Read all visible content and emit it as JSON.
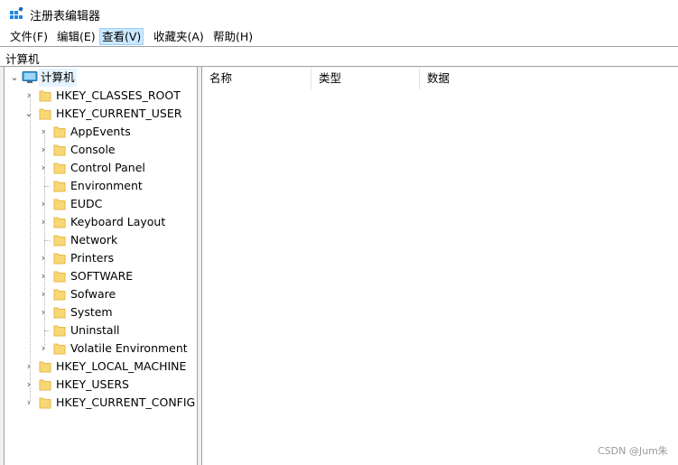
{
  "window": {
    "title": "注册表编辑器",
    "icon": "registry-editor-icon"
  },
  "menu": [
    "文件(F)",
    "编辑(E)",
    "查看(V)",
    "收藏夹(A)",
    "帮助(H)"
  ],
  "address": "计算机",
  "tree": {
    "root": "计算机",
    "hives": [
      "HKEY_CLASSES_ROOT",
      "HKEY_CURRENT_USER",
      "HKEY_LOCAL_MACHINE",
      "HKEY_USERS",
      "HKEY_CURRENT_CONFIG"
    ],
    "current_user_children": [
      "AppEvents",
      "Console",
      "Control Panel",
      "Environment",
      "EUDC",
      "Keyboard Layout",
      "Network",
      "Printers",
      "SOFTWARE",
      "Sofware",
      "System",
      "Uninstall",
      "Volatile Environment"
    ]
  },
  "columns": [
    "名称",
    "类型",
    "数据"
  ],
  "watermark": "CSDN @Jum朱",
  "colors": {
    "folder": "#f8d775",
    "folder_dark": "#e6b84a",
    "selection": "#cce8ff",
    "monitor": "#4aa3df"
  }
}
